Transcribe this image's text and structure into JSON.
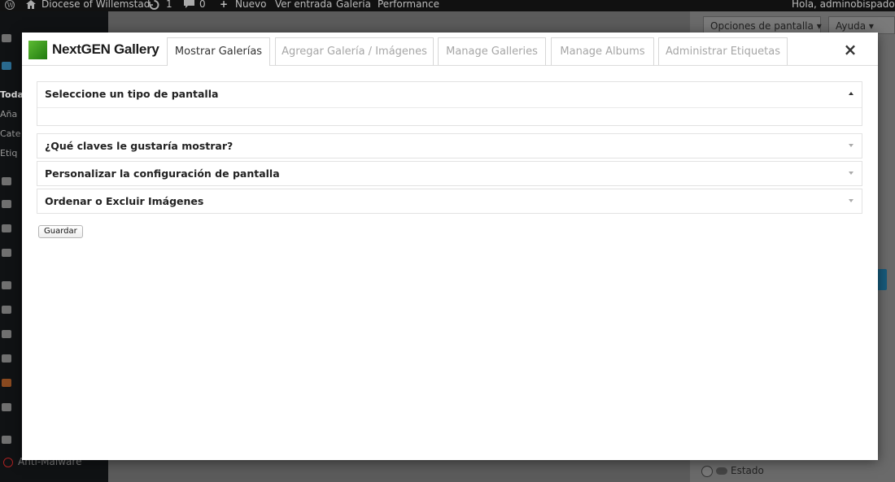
{
  "adminbar": {
    "site_name": "Diocese of Willemstad",
    "updates_count": "1",
    "comments_count": "0",
    "new_label": "Nuevo",
    "view_post": "Ver entrada",
    "gallery": "Galería",
    "performance": "Performance",
    "greeting": "Hola, adminobispado"
  },
  "background": {
    "screen_options": "Opciones de pantalla",
    "help": "Ayuda",
    "sidebar_items": [
      "Toda",
      "Aña",
      "Cate",
      "Etiq"
    ],
    "anti_malware": "Anti-Malware",
    "estado": "Estado"
  },
  "modal": {
    "brand": "NextGEN Gallery",
    "tabs": [
      {
        "label": "Mostrar Galerías",
        "active": true
      },
      {
        "label": "Agregar Galería / Imágenes",
        "active": false
      },
      {
        "label": "Manage Galleries",
        "active": false
      },
      {
        "label": "Manage Albums",
        "active": false
      },
      {
        "label": "Administrar Etiquetas",
        "active": false
      }
    ],
    "close_symbol": "×",
    "panels": [
      {
        "title": "Seleccione un tipo de pantalla",
        "expanded": true
      },
      {
        "title": "¿Qué claves le gustaría mostrar?",
        "expanded": false
      },
      {
        "title": "Personalizar la configuración de pantalla",
        "expanded": false
      },
      {
        "title": "Ordenar o Excluir Imágenes",
        "expanded": false
      }
    ],
    "save_label": "Guardar"
  },
  "colors": {
    "brand_green": "#3e9b22",
    "accent_blue": "#175b7c"
  }
}
